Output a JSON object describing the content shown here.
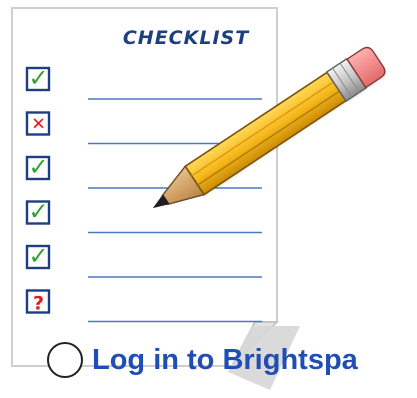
{
  "checklist": {
    "title": "CHECKLIST",
    "items": [
      {
        "status": "checked",
        "mark": "✓"
      },
      {
        "status": "crossed",
        "mark": "✕"
      },
      {
        "status": "checked",
        "mark": "✓"
      },
      {
        "status": "checked",
        "mark": "✓"
      },
      {
        "status": "checked",
        "mark": "✓"
      },
      {
        "status": "unknown",
        "mark": "?"
      }
    ]
  },
  "task": {
    "label": "Log in to Brightspa"
  },
  "colors": {
    "check": "#2ea42e",
    "cross": "#e11b1b",
    "question": "#e11b1b",
    "box_border": "#1d3f7f",
    "line": "#4a78c2",
    "link": "#1f4eb4"
  },
  "icons": {
    "illustration": "pencil-checklist-icon"
  }
}
